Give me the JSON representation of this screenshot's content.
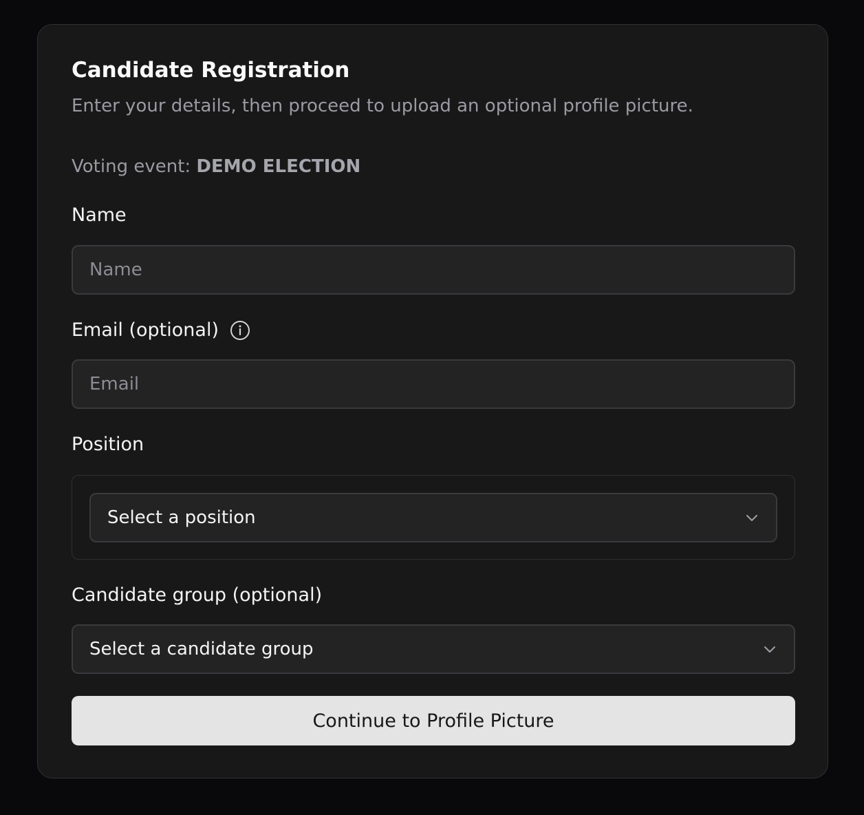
{
  "form": {
    "title": "Candidate Registration",
    "subtitle": "Enter your details, then proceed to upload an optional profile picture.",
    "event_prefix": "Voting event: ",
    "event_name": "DEMO ELECTION",
    "name_label": "Name",
    "name_placeholder": "Name",
    "name_value": "",
    "email_label": "Email (optional)",
    "email_placeholder": "Email",
    "email_value": "",
    "email_info_icon": "info-icon",
    "position_label": "Position",
    "position_selected": "Select a position",
    "group_label": "Candidate group (optional)",
    "group_selected": "Select a candidate group",
    "submit_label": "Continue to Profile Picture"
  },
  "colors": {
    "background": "#09090b",
    "card": "#181818",
    "input_bg": "#232323",
    "border": "#3a3a3f",
    "button_bg": "#e4e4e4",
    "button_text": "#18181b"
  }
}
